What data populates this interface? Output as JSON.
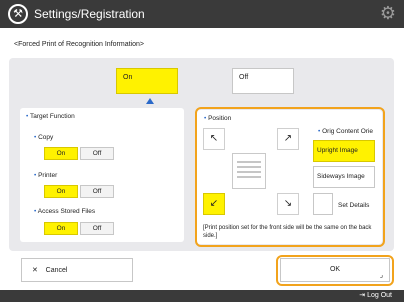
{
  "header": {
    "title": "Settings/Registration",
    "app_icon": "settings-wrench-icon",
    "gear_icon": "gear-icon"
  },
  "subtitle": "<Forced Print of Recognition Information>",
  "main_toggle": {
    "on": "On",
    "off": "Off",
    "selected": "On"
  },
  "target_function": {
    "title": "Target Function",
    "items": [
      {
        "label": "Copy",
        "on": "On",
        "off": "Off",
        "selected": "On"
      },
      {
        "label": "Printer",
        "on": "On",
        "off": "Off",
        "selected": "On"
      },
      {
        "label": "Access Stored Files",
        "on": "On",
        "off": "Off",
        "selected": "On"
      }
    ]
  },
  "position": {
    "title": "Position",
    "orig_title": "Orig Content Orie",
    "upright": "Upright Image",
    "sideways": "Sideways Image",
    "set_details": "Set Details",
    "note": "[Print position set for the front side will be the same on the back side.]",
    "selected_corner": "bottom-left"
  },
  "footer": {
    "cancel": "Cancel",
    "ok": "OK",
    "logout": "Log Out"
  },
  "colors": {
    "accent": "#2a69c9",
    "selected": "#fff200",
    "highlight": "#f2a31c"
  }
}
